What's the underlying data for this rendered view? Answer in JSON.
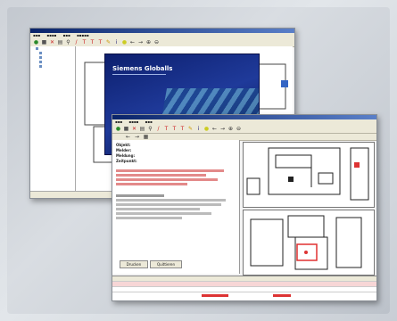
{
  "back_window": {
    "tree_items": [
      "",
      "",
      "",
      "",
      ""
    ],
    "status_text": ""
  },
  "splash": {
    "title": "Siemens Globalls"
  },
  "front_window": {
    "report_fields": [
      {
        "label": "Objekt:",
        "value": ""
      },
      {
        "label": "Melder:",
        "value": ""
      },
      {
        "label": "Meldung:",
        "value": ""
      },
      {
        "label": "Zeitpunkt:",
        "value": ""
      }
    ],
    "buttons": {
      "left": "Drucken",
      "right": "Quittieren"
    }
  }
}
